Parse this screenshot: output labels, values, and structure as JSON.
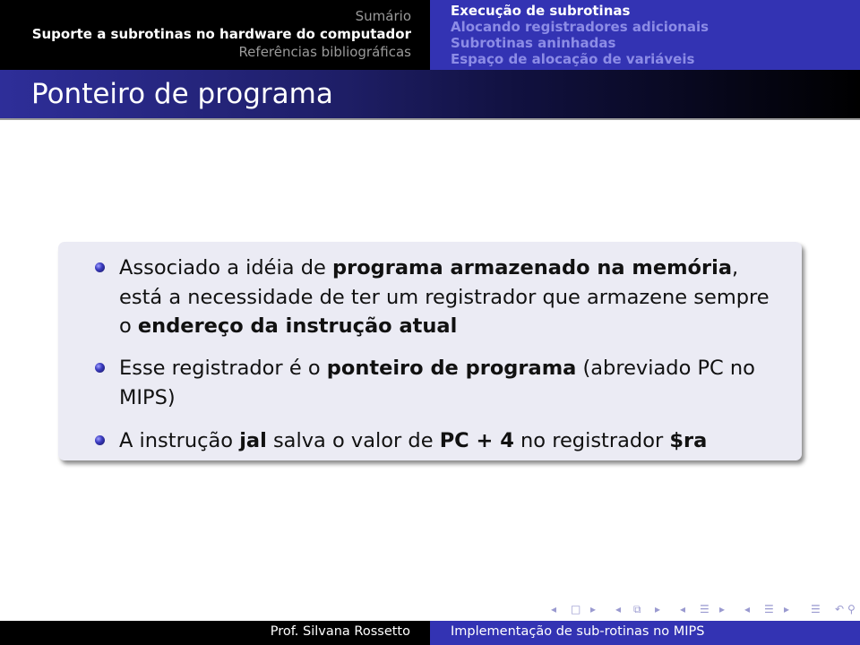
{
  "header": {
    "sections": [
      {
        "label": "Sumário",
        "active": false
      },
      {
        "label": "Suporte a subrotinas no hardware do computador",
        "active": true
      },
      {
        "label": "Referências bibliográficas",
        "active": false
      }
    ],
    "subsections": [
      {
        "label": "Execução de subrotinas",
        "active": true
      },
      {
        "label": "Alocando registradores adicionais",
        "active": false
      },
      {
        "label": "Subrotinas aninhadas",
        "active": false
      },
      {
        "label": "Espaço de alocação de variáveis",
        "active": false
      }
    ]
  },
  "frame": {
    "title": "Ponteiro de programa",
    "items": [
      {
        "lines": [
          [
            {
              "t": "Associado a idéia de ",
              "b": false
            },
            {
              "t": "programa armazenado na memória",
              "b": true
            },
            {
              "t": ",",
              "b": false
            }
          ],
          [
            {
              "t": "está a necessidade de ter um registrador que armazene sempre",
              "b": false
            }
          ],
          [
            {
              "t": "o ",
              "b": false
            },
            {
              "t": "endereço da instrução atual",
              "b": true
            }
          ]
        ]
      },
      {
        "lines": [
          [
            {
              "t": "Esse registrador é o ",
              "b": false
            },
            {
              "t": "ponteiro de programa",
              "b": true
            },
            {
              "t": " (abreviado PC no",
              "b": false
            }
          ],
          [
            {
              "t": "MIPS)",
              "b": false
            }
          ]
        ]
      },
      {
        "lines": [
          [
            {
              "t": "A instrução ",
              "b": false
            },
            {
              "t": "jal",
              "b": true
            },
            {
              "t": " salva o valor de ",
              "b": false
            },
            {
              "t": "PC + 4",
              "b": true
            },
            {
              "t": " no registrador ",
              "b": false
            },
            {
              "t": "$ra",
              "b": true
            }
          ]
        ]
      }
    ]
  },
  "nav": {
    "icons": [
      "◂",
      "□",
      "▸",
      "◂",
      "⧉",
      "▸",
      "◂",
      "☰",
      "▸",
      "◂",
      "☰",
      "▸",
      "☰",
      "↶",
      "⚲",
      "↷"
    ],
    "names": [
      "prev-slide-icon",
      "slide-icon",
      "next-slide-icon",
      "prev-frame-icon",
      "frame-icon",
      "next-frame-icon",
      "prev-subsection-icon",
      "subsection-icon",
      "next-subsection-icon",
      "prev-section-icon",
      "section-icon",
      "next-section-icon",
      "outline-icon",
      "back-icon",
      "search-icon",
      "forward-icon"
    ]
  },
  "footer": {
    "author": "Prof. Silvana Rossetto",
    "title": "Implementação de sub-rotinas no MIPS"
  },
  "colors": {
    "structure": "#3333b3",
    "block_bg": "#ebebf4"
  }
}
